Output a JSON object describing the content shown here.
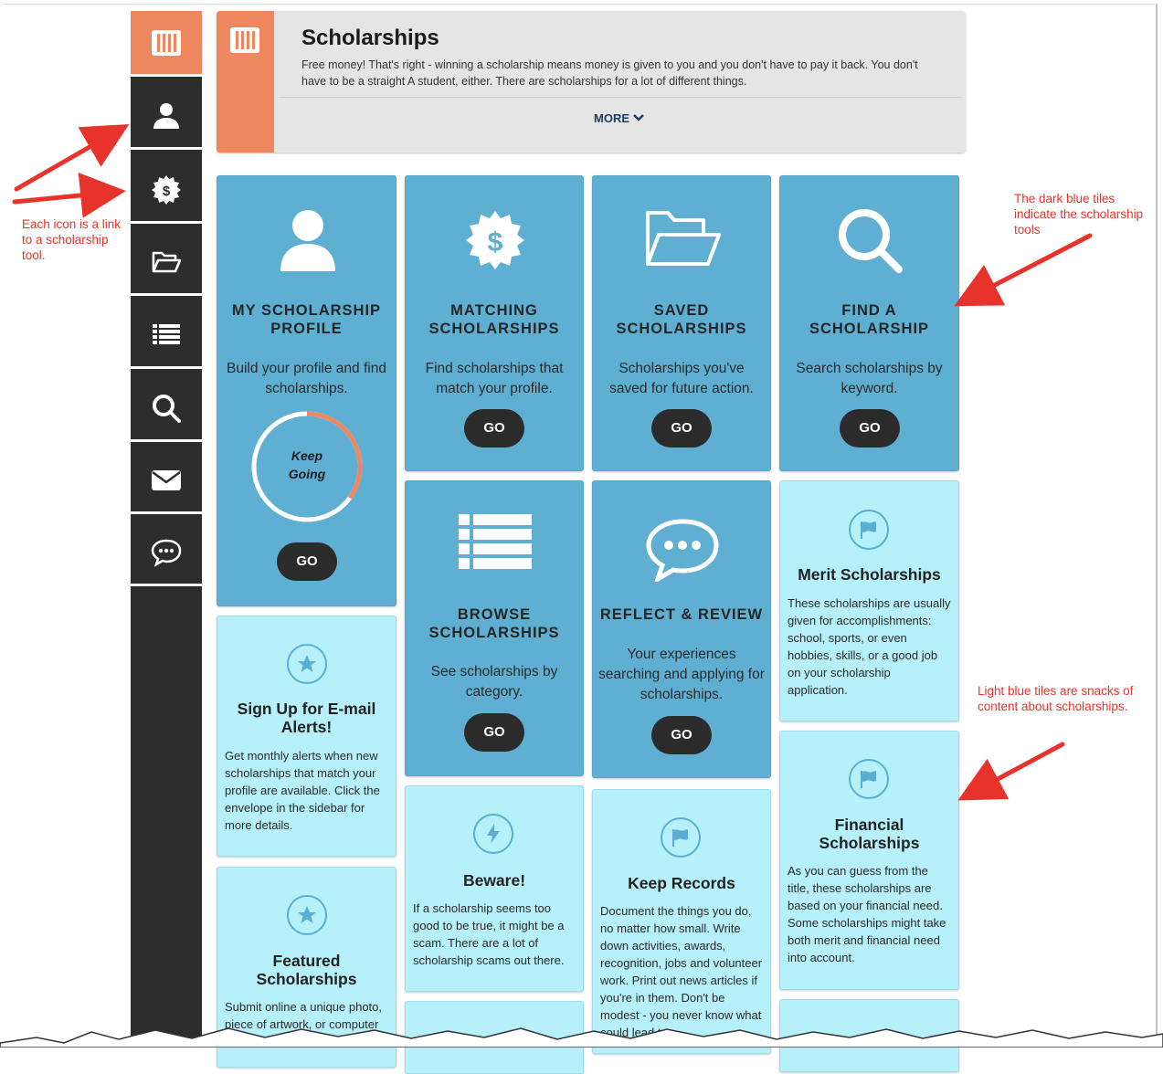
{
  "header": {
    "title": "Scholarships",
    "description": "Free money! That's right - winning a scholarship means money is given to you and you don't have to pay it back. You don't have to be a straight A student, either. There are scholarships for a lot of different things.",
    "more_label": "MORE"
  },
  "sidebar": {
    "items": [
      {
        "icon": "books-icon"
      },
      {
        "icon": "user-icon"
      },
      {
        "icon": "dollar-badge-icon"
      },
      {
        "icon": "folder-open-icon"
      },
      {
        "icon": "list-icon"
      },
      {
        "icon": "search-icon"
      },
      {
        "icon": "envelope-icon"
      },
      {
        "icon": "chat-bubble-icon"
      }
    ]
  },
  "tiles": {
    "profile": {
      "title": "MY SCHOLARSHIP PROFILE",
      "desc": "Build your profile and find scholarships.",
      "progress_label": "Keep Going",
      "progress": 0.35,
      "go": "GO"
    },
    "matching": {
      "title": "MATCHING SCHOLARSHIPS",
      "desc": "Find scholarships that match your profile.",
      "go": "GO"
    },
    "saved": {
      "title": "SAVED SCHOLARSHIPS",
      "desc": "Scholarships you've saved for future action.",
      "go": "GO"
    },
    "find": {
      "title": "FIND A SCHOLARSHIP",
      "desc": "Search scholarships by keyword.",
      "go": "GO"
    },
    "browse": {
      "title": "BROWSE SCHOLARSHIPS",
      "desc": "See scholarships by category.",
      "go": "GO"
    },
    "reflect": {
      "title": "REFLECT & REVIEW",
      "desc": "Your experiences searching and applying for scholarships.",
      "go": "GO"
    },
    "merit": {
      "title": "Merit Scholarships",
      "text": "These scholarships are usually given for accomplishments: school, sports, or even hobbies, skills, or a good job on your scholarship application."
    },
    "signup": {
      "title": "Sign Up for E-mail Alerts!",
      "text": "Get monthly alerts when new scholarships that match your profile are available. Click the envelope in the sidebar for more details."
    },
    "financial": {
      "title": "Financial Scholarships",
      "text": "As you can guess from the title, these scholarships are based on your financial need. Some scholarships might take both merit and financial need into account."
    },
    "beware": {
      "title": "Beware!",
      "text": "If a scholarship seems too good to be true, it might be a scam. There are a lot of scholarship scams out there."
    },
    "records": {
      "title": "Keep Records",
      "text": "Document the things you do, no matter how small. Write down activities, awards, recognition, jobs and volunteer work. Print out news articles if you're in them. Don't be modest - you never know what could lead to a"
    },
    "featured": {
      "title": "Featured Scholarships",
      "text": "Submit online a unique photo, piece of artwork, or computer"
    }
  },
  "annotations": {
    "icons": "Each icon is a link to a scholarship tool.",
    "dark_tiles": "The dark blue tiles indicate the scholarship tools",
    "light_tiles": "Light blue tiles are snacks of content about scholarships."
  },
  "colors": {
    "accent": "#ee8660",
    "sidebar": "#2d2d2d",
    "dark_tile": "#5fafd2",
    "light_tile": "#b5f0fb",
    "annotation": "#e8332c"
  }
}
